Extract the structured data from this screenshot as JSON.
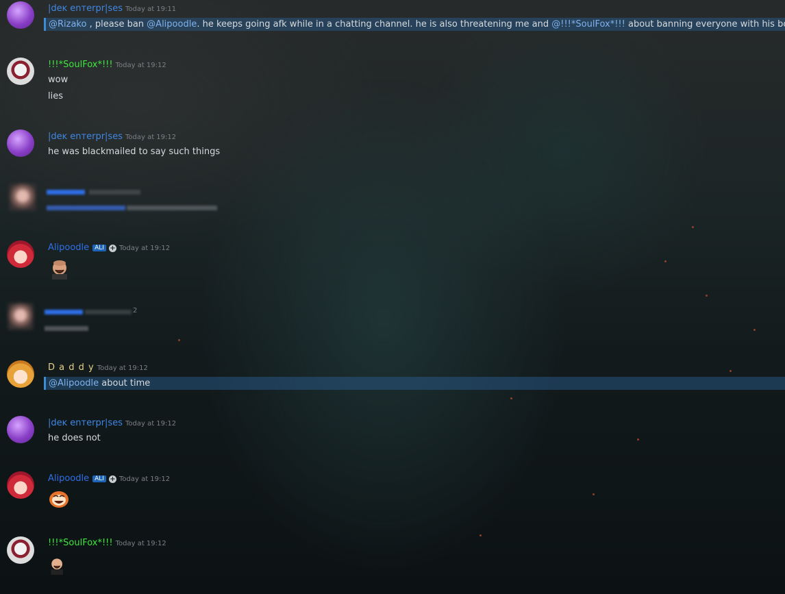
{
  "colors": {
    "dek": "#3f88e6",
    "soulfox": "#3fe63f",
    "alipoodle": "#2f6fe8",
    "daddy": "#e6d38a"
  },
  "messages": [
    {
      "user": "|deĸ enтerpr|ses",
      "time": "Today at 19:11",
      "m1": "@Rizako",
      "t1": " , please ban ",
      "m2": "@Alipoodle",
      "t2": ". he keeps going afk while in a chatting  channel. he is also threatening me and ",
      "m3": "@!!!*SoulFox*!!!",
      "t3": " about banning everyone with his bot."
    },
    {
      "user": "!!!*SoulFox*!!!",
      "time": "Today at 19:12",
      "line1": "wow",
      "line2": "lies"
    },
    {
      "user": "|deĸ enтerpr|ses",
      "time": "Today at 19:12",
      "line1": "he was blackmailed to say such things"
    },
    {
      "user": "Alipoodle",
      "tag": "ALI",
      "time": "Today at 19:12",
      "emoji": "laughing-man-emoji"
    },
    {
      "trailing": "2"
    },
    {
      "user": "D a d d y",
      "time": "Today at 19:12",
      "mention": "@Alipoodle",
      "line1": " about time"
    },
    {
      "user": "|deĸ enтerpr|ses",
      "time": "Today at 19:12",
      "line1": "he does not"
    },
    {
      "user": "Alipoodle",
      "tag": "ALI",
      "time": "Today at 19:12",
      "emoji": "fire-face-emoji"
    },
    {
      "user": "!!!*SoulFox*!!!",
      "time": "Today at 19:12",
      "emoji": "laughing-man-emoji"
    }
  ]
}
